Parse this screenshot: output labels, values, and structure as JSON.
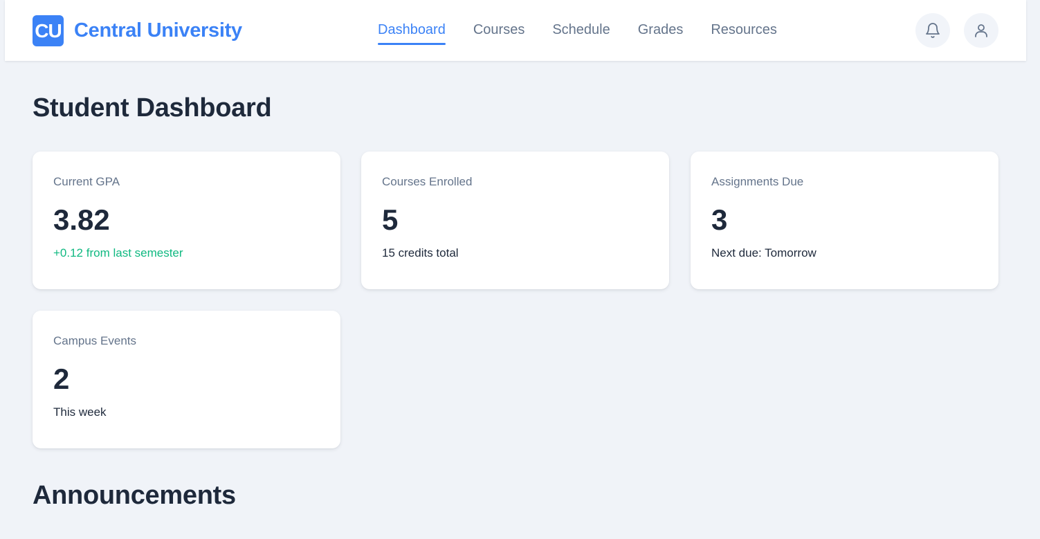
{
  "brand": {
    "logo_text": "CU",
    "name": "Central University"
  },
  "nav": {
    "items": [
      {
        "label": "Dashboard",
        "active": true
      },
      {
        "label": "Courses",
        "active": false
      },
      {
        "label": "Schedule",
        "active": false
      },
      {
        "label": "Grades",
        "active": false
      },
      {
        "label": "Resources",
        "active": false
      }
    ]
  },
  "header_actions": {
    "icons": [
      "bell-icon",
      "user-icon"
    ]
  },
  "page": {
    "title": "Student Dashboard"
  },
  "stats": [
    {
      "label": "Current GPA",
      "value": "3.82",
      "note": "+0.12 from last semester",
      "note_positive": true
    },
    {
      "label": "Courses Enrolled",
      "value": "5",
      "note": "15 credits total",
      "note_positive": false
    },
    {
      "label": "Assignments Due",
      "value": "3",
      "note": "Next due: Tomorrow",
      "note_positive": false
    },
    {
      "label": "Campus Events",
      "value": "2",
      "note": "This week",
      "note_positive": false
    }
  ],
  "announcements": {
    "title": "Announcements"
  },
  "colors": {
    "accent": "#3b82f6",
    "positive": "#10b981",
    "background": "#f0f3f8",
    "text": "#1e293b",
    "muted": "#64748b"
  }
}
